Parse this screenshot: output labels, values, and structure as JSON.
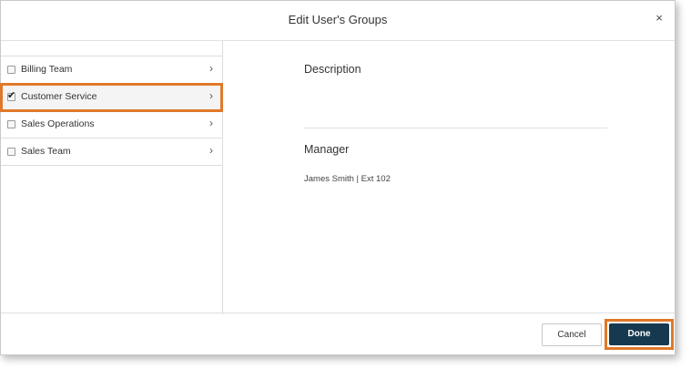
{
  "dialog": {
    "title": "Edit User's Groups",
    "close_icon": "close-icon",
    "close_glyph": "×"
  },
  "groups": [
    {
      "label": "Billing Team",
      "checked": false
    },
    {
      "label": "Customer Service",
      "checked": true
    },
    {
      "label": "Sales Operations",
      "checked": false
    },
    {
      "label": "Sales Team",
      "checked": false
    }
  ],
  "chevron_glyph": "›",
  "check_glyph": "✔",
  "details": {
    "description_title": "Description",
    "manager_title": "Manager",
    "manager_value": "James Smith | Ext 102"
  },
  "footer": {
    "cancel_label": "Cancel",
    "done_label": "Done"
  },
  "colors": {
    "highlight": "#e0792a",
    "primary": "#17394f"
  }
}
